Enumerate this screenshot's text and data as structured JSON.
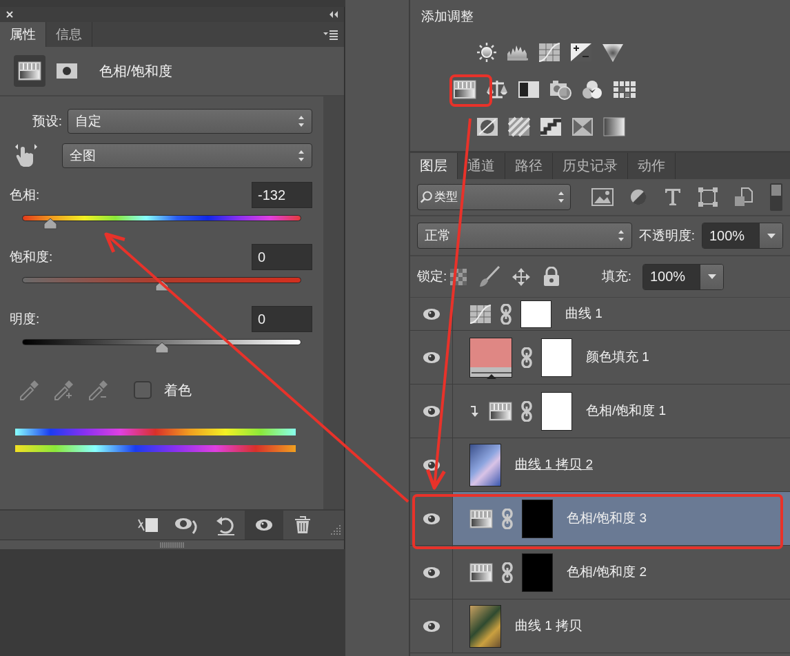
{
  "properties_panel": {
    "tabs": [
      {
        "label": "属性",
        "selected": true
      },
      {
        "label": "信息",
        "selected": false
      }
    ],
    "title": "色相/饱和度",
    "preset": {
      "label": "预设:",
      "value": "自定"
    },
    "channel": {
      "value": "全图"
    },
    "sliders": [
      {
        "kind": "hue",
        "label": "色相:",
        "value": "-132",
        "level": 0.1
      },
      {
        "kind": "saturation",
        "label": "饱和度:",
        "value": "0",
        "level": 0.5
      },
      {
        "kind": "lightness",
        "label": "明度:",
        "value": "0",
        "level": 0.5
      }
    ],
    "colorize": {
      "label": "着色",
      "checked": false
    }
  },
  "adjustments_panel": {
    "title": "添加调整"
  },
  "layers_panel": {
    "tabs": [
      {
        "label": "图层",
        "selected": true
      },
      {
        "label": "通道",
        "selected": false
      },
      {
        "label": "路径",
        "selected": false
      },
      {
        "label": "历史记录",
        "selected": false
      },
      {
        "label": "动作",
        "selected": false
      }
    ],
    "filter": {
      "value": "类型",
      "enabled": true
    },
    "blend_mode": {
      "value": "正常"
    },
    "opacity": {
      "label": "不透明度:",
      "value": "100%"
    },
    "lock": {
      "label": "锁定:"
    },
    "fill": {
      "label": "填充:",
      "value": "100%"
    },
    "layers": [
      {
        "kind": "curves",
        "name": "曲线 1",
        "visible": true,
        "selected": false,
        "clipped": false,
        "underlined": false,
        "mask_black": false
      },
      {
        "kind": "fill",
        "name": "颜色填充 1",
        "visible": true,
        "selected": false,
        "clipped": false,
        "underlined": false,
        "mask_black": false,
        "color": "#df8784"
      },
      {
        "kind": "hue",
        "name": "色相/饱和度 1",
        "visible": true,
        "selected": false,
        "clipped": true,
        "underlined": false,
        "mask_black": false
      },
      {
        "kind": "photo",
        "name": "曲线 1 拷贝 2",
        "visible": true,
        "selected": false,
        "clipped": false,
        "underlined": true
      },
      {
        "kind": "hue",
        "name": "色相/饱和度 3",
        "visible": true,
        "selected": true,
        "clipped": false,
        "underlined": false,
        "mask_black": true
      },
      {
        "kind": "hue",
        "name": "色相/饱和度 2",
        "visible": true,
        "selected": false,
        "clipped": false,
        "underlined": false,
        "mask_black": true
      },
      {
        "kind": "photo",
        "name": "曲线 1 拷贝",
        "visible": true,
        "selected": false,
        "clipped": false,
        "underlined": false
      }
    ]
  }
}
